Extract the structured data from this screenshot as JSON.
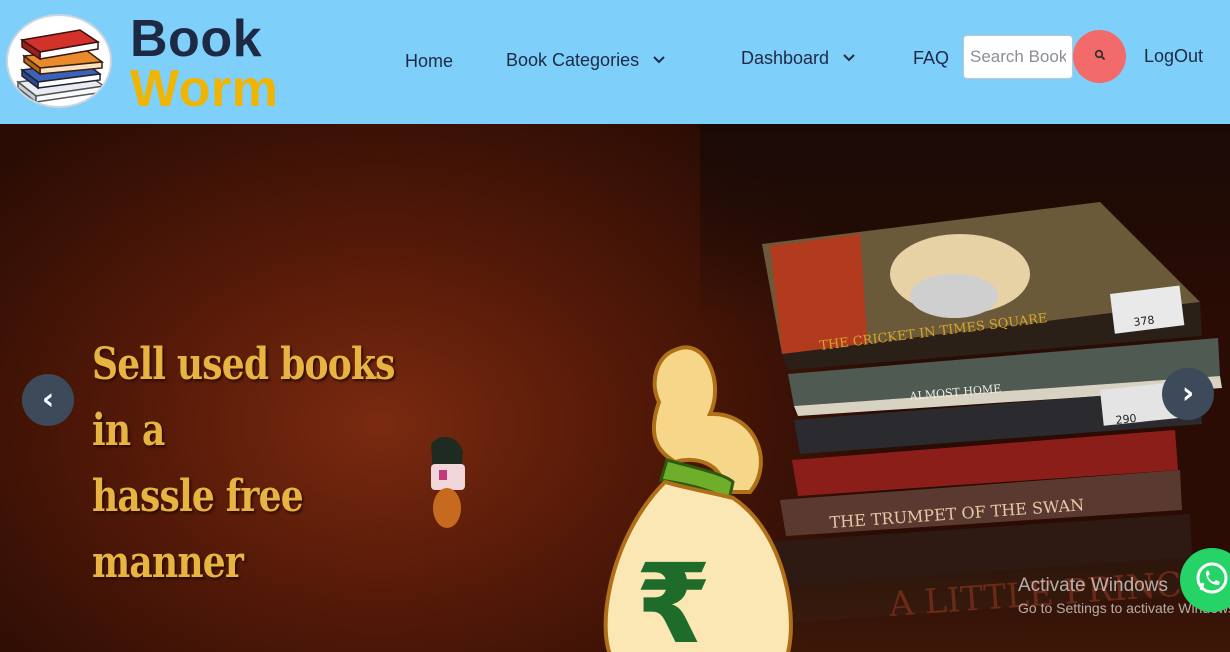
{
  "brand": {
    "line1": "Book",
    "line2": "Worm"
  },
  "nav": {
    "home": "Home",
    "categories": "Book Categories",
    "dashboard": "Dashboard",
    "faq": "FAQ",
    "logout": "LogOut"
  },
  "search": {
    "placeholder": "Search Book"
  },
  "hero": {
    "caption_line1": "Sell used books in a",
    "caption_line2": "hassle free manner",
    "prev_label": "‹",
    "next_label": "›",
    "book_titles": [
      "THE CRICKET IN TIMES SQUARE",
      "ALMOST HOME",
      "THE TRUMPET OF THE SWAN",
      "A LITTLE PRINCESS"
    ],
    "price_tags": [
      "378",
      "290"
    ],
    "currency_symbol": "₹"
  },
  "watermark": {
    "line1": "Activate Windows",
    "line2": "Go to Settings to activate Windows."
  },
  "colors": {
    "navbar_bg": "#7fcffb",
    "brand_dark": "#1e2a44",
    "brand_yellow": "#f0b500",
    "search_button": "#f36a6a",
    "caption_gold": "#e8b441",
    "whatsapp_green": "#25d366"
  },
  "icons": {
    "logo": "stack-of-books-icon",
    "search": "search-icon",
    "chevron": "chevron-down-icon",
    "whatsapp": "whatsapp-icon"
  }
}
